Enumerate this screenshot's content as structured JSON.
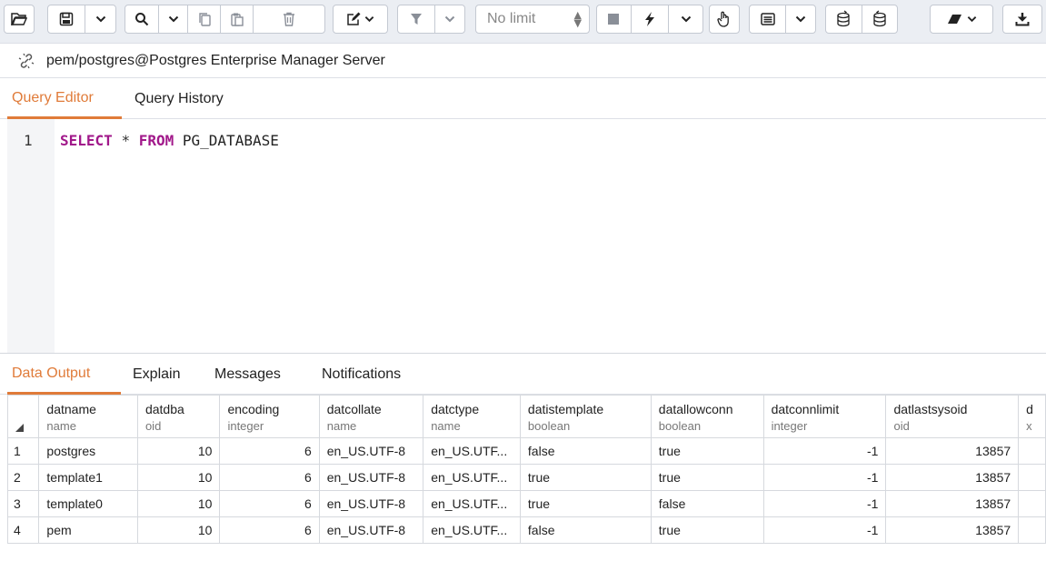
{
  "toolbar": {
    "limit_value": "No limit",
    "icons": [
      "folder-open-icon",
      "save-icon",
      "chevron-down-icon",
      "search-icon",
      "chevron-down-icon",
      "copy-icon",
      "paste-icon",
      "trash-icon",
      "edit-icon",
      "chevron-down-icon",
      "filter-icon",
      "chevron-down-icon",
      "stop-icon",
      "execute-icon",
      "chevron-down-icon",
      "hand-icon",
      "explain-icon",
      "chevron-down-icon",
      "commit-icon",
      "rollback-icon",
      "eraser-icon",
      "chevron-down-icon",
      "download-icon"
    ]
  },
  "connection": {
    "label": "pem/postgres@Postgres Enterprise Manager Server"
  },
  "editor_tabs": [
    {
      "label": "Query Editor",
      "active": true
    },
    {
      "label": "Query History",
      "active": false
    }
  ],
  "editor": {
    "line_number": "1",
    "tokens": {
      "kw1": "SELECT",
      "star": "*",
      "kw2": "FROM",
      "table": "PG_DATABASE"
    }
  },
  "output_tabs": [
    {
      "label": "Data Output",
      "active": true
    },
    {
      "label": "Explain",
      "active": false
    },
    {
      "label": "Messages",
      "active": false
    },
    {
      "label": "Notifications",
      "active": false
    }
  ],
  "grid": {
    "columns": [
      {
        "name": "datname",
        "type": "name"
      },
      {
        "name": "datdba",
        "type": "oid"
      },
      {
        "name": "encoding",
        "type": "integer"
      },
      {
        "name": "datcollate",
        "type": "name"
      },
      {
        "name": "datctype",
        "type": "name"
      },
      {
        "name": "datistemplate",
        "type": "boolean"
      },
      {
        "name": "datallowconn",
        "type": "boolean"
      },
      {
        "name": "datconnlimit",
        "type": "integer"
      },
      {
        "name": "datlastsysoid",
        "type": "oid"
      },
      {
        "name": "d",
        "type": "x"
      }
    ],
    "rows": [
      {
        "n": "1",
        "cells": [
          "postgres",
          "10",
          "6",
          "en_US.UTF-8",
          "en_US.UTF...",
          "false",
          "true",
          "-1",
          "13857",
          ""
        ]
      },
      {
        "n": "2",
        "cells": [
          "template1",
          "10",
          "6",
          "en_US.UTF-8",
          "en_US.UTF...",
          "true",
          "true",
          "-1",
          "13857",
          ""
        ]
      },
      {
        "n": "3",
        "cells": [
          "template0",
          "10",
          "6",
          "en_US.UTF-8",
          "en_US.UTF...",
          "true",
          "false",
          "-1",
          "13857",
          ""
        ]
      },
      {
        "n": "4",
        "cells": [
          "pem",
          "10",
          "6",
          "en_US.UTF-8",
          "en_US.UTF...",
          "false",
          "true",
          "-1",
          "13857",
          ""
        ]
      }
    ]
  },
  "colors": {
    "accent": "#e07b39",
    "keyword": "#a1188a"
  }
}
